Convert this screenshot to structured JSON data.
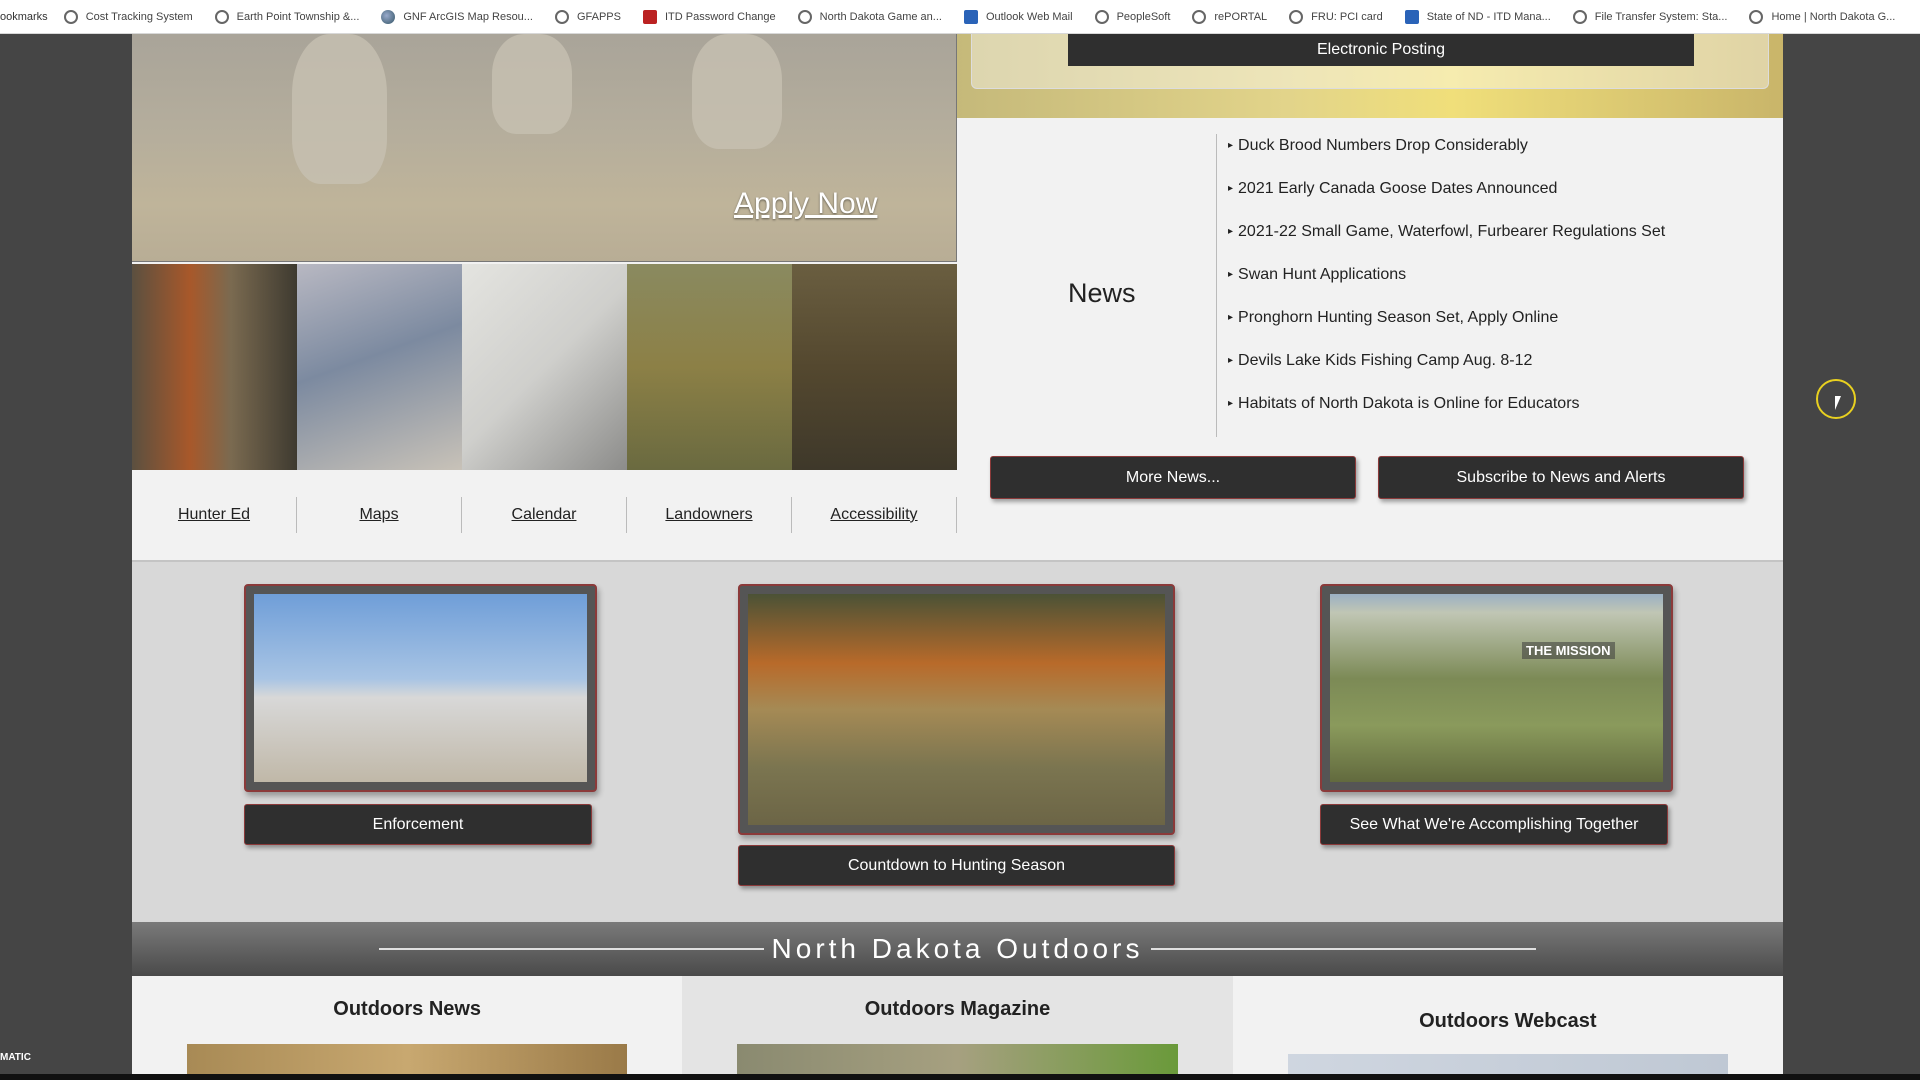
{
  "bookmarks": {
    "lead": "ookmarks",
    "items": [
      {
        "label": "Cost Tracking System",
        "icon": "globe-icon"
      },
      {
        "label": "Earth Point Township &...",
        "icon": "globe-icon"
      },
      {
        "label": "GNF ArcGIS Map Resou...",
        "icon": "arcgis-icon"
      },
      {
        "label": "GFAPPS",
        "icon": "globe-icon"
      },
      {
        "label": "ITD Password Change",
        "icon": "nd-icon"
      },
      {
        "label": "North Dakota Game an...",
        "icon": "deer-icon"
      },
      {
        "label": "Outlook Web Mail",
        "icon": "outlook-icon"
      },
      {
        "label": "PeopleSoft",
        "icon": "globe-icon"
      },
      {
        "label": "rePORTAL",
        "icon": "globe-icon"
      },
      {
        "label": "FRU: PCI card",
        "icon": "globe-icon"
      },
      {
        "label": "State of ND - ITD Mana...",
        "icon": "ip-icon"
      },
      {
        "label": "File Transfer System: Sta...",
        "icon": "globe-icon"
      },
      {
        "label": "Home | North Dakota G...",
        "icon": "deer-icon"
      }
    ]
  },
  "hero": {
    "apply_label": "Apply Now"
  },
  "quicklinks": [
    "Hunter Ed",
    "Maps",
    "Calendar",
    "Landowners",
    "Accessibility"
  ],
  "posting": {
    "label": "Electronic Posting"
  },
  "news": {
    "title": "News",
    "items": [
      "Duck Brood Numbers Drop Considerably",
      "2021 Early Canada Goose Dates Announced",
      "2021-22 Small Game, Waterfowl, Furbearer Regulations Set",
      "Swan Hunt Applications",
      "Pronghorn Hunting Season Set, Apply Online",
      "Devils Lake Kids Fishing Camp Aug. 8-12",
      "Habitats of North Dakota is Online for Educators"
    ],
    "more_label": "More News...",
    "subscribe_label": "Subscribe to News and Alerts"
  },
  "features": {
    "enforcement_label": "Enforcement",
    "countdown_label": "Countdown to Hunting Season",
    "mission_label": "See What We're Accomplishing Together",
    "mission_overlay": "THE MISSION"
  },
  "outdoors": {
    "band_title": "North Dakota Outdoors",
    "columns": [
      "Outdoors News",
      "Outdoors Magazine",
      "Outdoors Webcast"
    ]
  },
  "taskbar": {
    "label": "MATIC"
  },
  "colors": {
    "button_bg": "#2f2f2f",
    "button_border": "#8b3a3a",
    "cursor_ring": "#e8d020"
  }
}
